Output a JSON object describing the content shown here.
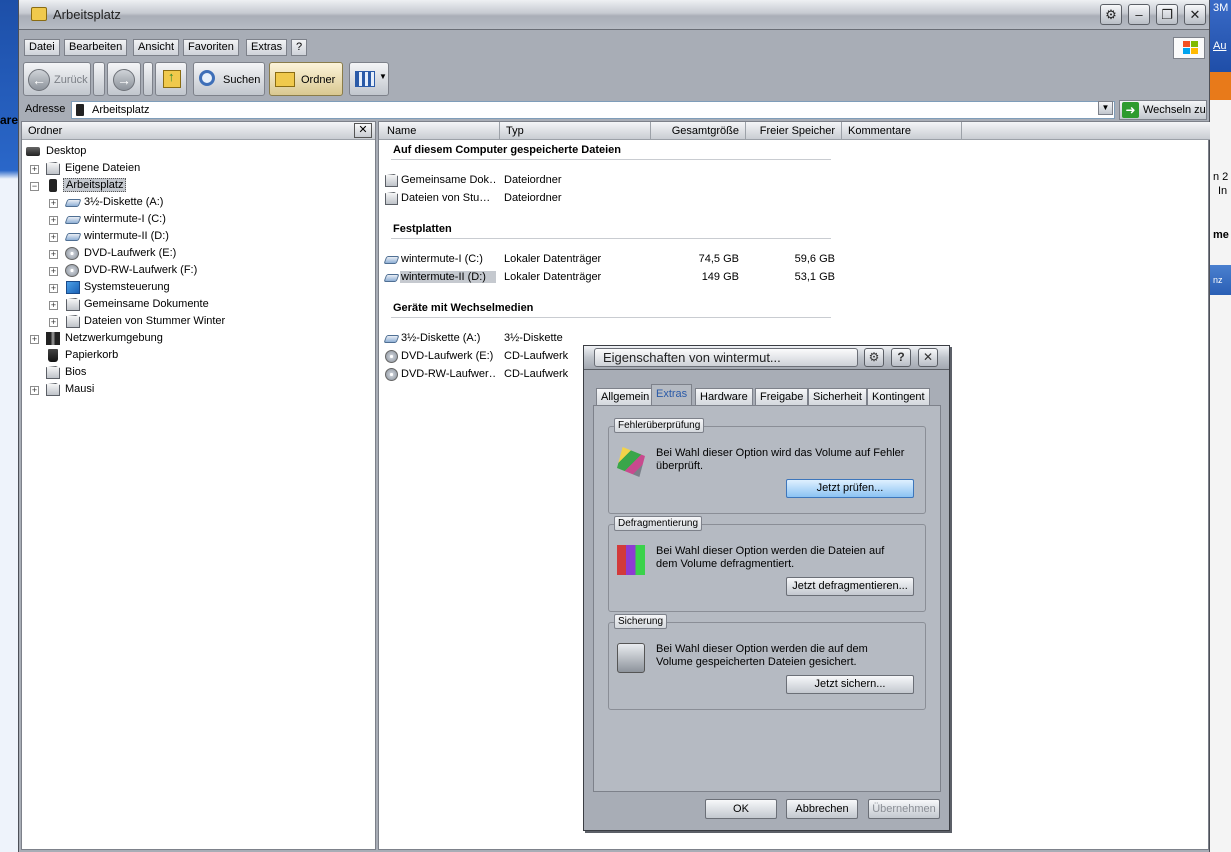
{
  "window": {
    "title": "Arbeitsplatz"
  },
  "menu": [
    "Datei",
    "Bearbeiten",
    "Ansicht",
    "Favoriten",
    "Extras",
    "?"
  ],
  "toolbar": {
    "back": "Zurück",
    "search": "Suchen",
    "folders": "Ordner"
  },
  "address": {
    "label": "Adresse",
    "value": "Arbeitsplatz",
    "go": "Wechseln zu"
  },
  "folders_pane": {
    "title": "Ordner",
    "items": [
      {
        "label": "Desktop",
        "icon": "desktop-icon"
      },
      {
        "label": "Eigene Dateien",
        "icon": "folder-icon"
      },
      {
        "label": "Arbeitsplatz",
        "icon": "computer-icon"
      },
      {
        "label": "3½-Diskette (A:)",
        "icon": "floppy-icon"
      },
      {
        "label": "wintermute-I (C:)",
        "icon": "drive-icon"
      },
      {
        "label": "wintermute-II (D:)",
        "icon": "drive-icon"
      },
      {
        "label": "DVD-Laufwerk (E:)",
        "icon": "dvd-icon"
      },
      {
        "label": "DVD-RW-Laufwerk (F:)",
        "icon": "dvd-icon"
      },
      {
        "label": "Systemsteuerung",
        "icon": "control-panel-icon"
      },
      {
        "label": "Gemeinsame Dokumente",
        "icon": "folder-icon"
      },
      {
        "label": "Dateien von Stummer Winter",
        "icon": "folder-icon"
      },
      {
        "label": "Netzwerkumgebung",
        "icon": "network-icon"
      },
      {
        "label": "Papierkorb",
        "icon": "recycle-bin-icon"
      },
      {
        "label": "Bios",
        "icon": "folder-icon"
      },
      {
        "label": "Mausi",
        "icon": "folder-icon"
      }
    ]
  },
  "list": {
    "columns": [
      "Name",
      "Typ",
      "Gesamtgröße",
      "Freier Speicher",
      "Kommentare"
    ],
    "groups": [
      {
        "title": "Auf diesem Computer gespeicherte Dateien",
        "rows": [
          {
            "name": "Gemeinsame Dok…",
            "type": "Dateiordner",
            "total": "",
            "free": ""
          },
          {
            "name": "Dateien von Stu…",
            "type": "Dateiordner",
            "total": "",
            "free": ""
          }
        ]
      },
      {
        "title": "Festplatten",
        "rows": [
          {
            "name": "wintermute-I (C:)",
            "type": "Lokaler Datenträger",
            "total": "74,5 GB",
            "free": "59,6 GB"
          },
          {
            "name": "wintermute-II (D:)",
            "type": "Lokaler Datenträger",
            "total": "149 GB",
            "free": "53,1 GB"
          }
        ]
      },
      {
        "title": "Geräte mit Wechselmedien",
        "rows": [
          {
            "name": "3½-Diskette (A:)",
            "type": "3½-Diskette",
            "total": "",
            "free": ""
          },
          {
            "name": "DVD-Laufwerk (E:)",
            "type": "CD-Laufwerk",
            "total": "",
            "free": ""
          },
          {
            "name": "DVD-RW-Laufwer…",
            "type": "CD-Laufwerk",
            "total": "",
            "free": ""
          }
        ]
      }
    ]
  },
  "dialog": {
    "title": "Eigenschaften von wintermut...",
    "tabs": [
      "Allgemein",
      "Extras",
      "Hardware",
      "Freigabe",
      "Sicherheit",
      "Kontingent"
    ],
    "active_tab": "Extras",
    "sections": [
      {
        "legend": "Fehlerüberprüfung",
        "text": "Bei Wahl dieser Option wird das Volume auf Fehler überprüft.",
        "button": "Jetzt prüfen..."
      },
      {
        "legend": "Defragmentierung",
        "text": "Bei Wahl dieser Option werden die Dateien auf dem Volume defragmentiert.",
        "button": "Jetzt defragmentieren..."
      },
      {
        "legend": "Sicherung",
        "text": "Bei Wahl dieser Option werden die auf dem Volume gespeicherten Dateien gesichert.",
        "button": "Jetzt sichern..."
      }
    ],
    "ok": "OK",
    "cancel": "Abbrechen",
    "apply": "Übernehmen"
  },
  "background": {
    "left_text": "are",
    "right_texts": [
      "3M",
      "Au",
      "n 2",
      "In",
      "me",
      "nz"
    ]
  },
  "colors": {
    "chrome": "#a8adb6",
    "selection": "#c5c9cf",
    "accent_blue": "#2a5aa8",
    "desktop": "#1d3d80"
  }
}
